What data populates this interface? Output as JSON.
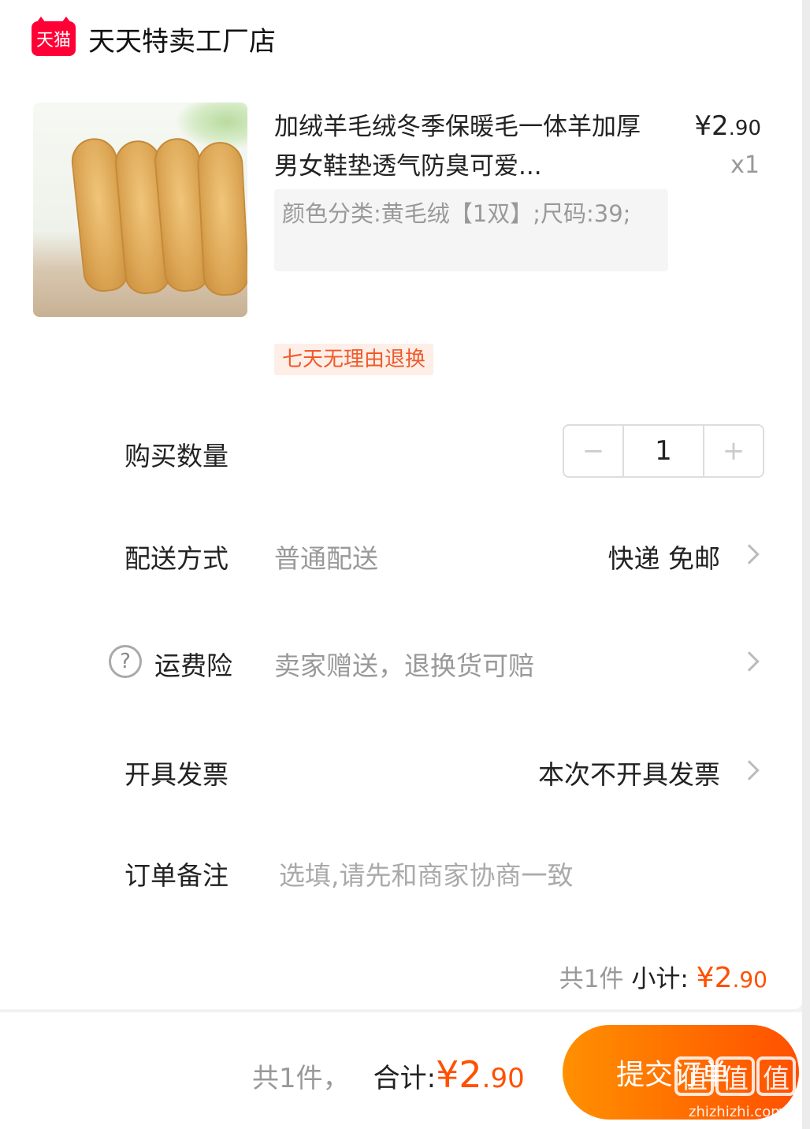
{
  "shop": {
    "badge": "天猫",
    "name": "天天特卖工厂店"
  },
  "product": {
    "title": "加绒羊毛绒冬季保暖毛一体羊加厚男女鞋垫透气防臭可爱...",
    "price_symbol": "¥",
    "price_int": "2",
    "price_dec": ".90",
    "quantity_mark": "x1",
    "sku": "颜色分类:黄毛绒【1双】;尺码:39;",
    "return_policy": "七天无理由退换"
  },
  "quantity": {
    "label": "购买数量",
    "minus": "−",
    "value": "1",
    "plus": "+"
  },
  "delivery": {
    "label": "配送方式",
    "value": "普通配送",
    "right": "快递 免邮"
  },
  "insurance": {
    "help": "?",
    "label": "运费险",
    "value": "卖家赠送，退换货可赔"
  },
  "invoice": {
    "label": "开具发票",
    "value": "本次不开具发票"
  },
  "note": {
    "label": "订单备注",
    "placeholder": "选填,请先和商家协商一致"
  },
  "subtotal": {
    "count": "共1件",
    "label": "小计:",
    "symbol": "¥",
    "int": "2",
    "dec": ".90"
  },
  "bottom": {
    "count": "共1件，",
    "label": "合计:",
    "symbol": "¥",
    "int": "2",
    "dec": ".90",
    "submit": "提交订单"
  },
  "watermark": {
    "chars": [
      "值",
      "值",
      "值"
    ],
    "url": "zhizhizhi.com"
  },
  "colors": {
    "accent": "#ff5000",
    "tmall": "#ff0036",
    "tag_bg": "#fdeee8"
  }
}
